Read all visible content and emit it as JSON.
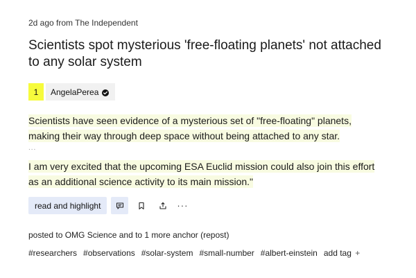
{
  "article": {
    "meta": "2d ago from The Independent",
    "title": "Scientists spot mysterious 'free-floating planets' not attached to any solar system"
  },
  "author": {
    "rank": "1",
    "name": "AngelaPerea",
    "verified_icon": "check-circle-icon"
  },
  "highlights": {
    "quote1": "Scientists have seen evidence of a mysterious set of \"free-floating\" planets, making their way through deep space without being attached to any star.",
    "separator": "...",
    "quote2": "I am very excited that the upcoming ESA Euclid mission could also join this effort as an additional science activity to its main mission.\""
  },
  "actions": {
    "read_label": "read and highlight",
    "comment_icon": "comment-icon",
    "bookmark_icon": "bookmark-icon",
    "share_icon": "share-icon",
    "more_label": "···"
  },
  "posted": {
    "text": "posted to OMG Science and to 1 more anchor  (repost)"
  },
  "tags": {
    "items": [
      "#researchers",
      "#observations",
      "#solar-system",
      "#small-number",
      "#albert-einstein"
    ],
    "add_label": "add tag",
    "add_icon": "+"
  },
  "colors": {
    "rank_badge": "#f6fb3c",
    "highlight": "#f8fbe1",
    "button_bg": "#e4eaf8",
    "chip_bg": "#f1f1f1"
  }
}
